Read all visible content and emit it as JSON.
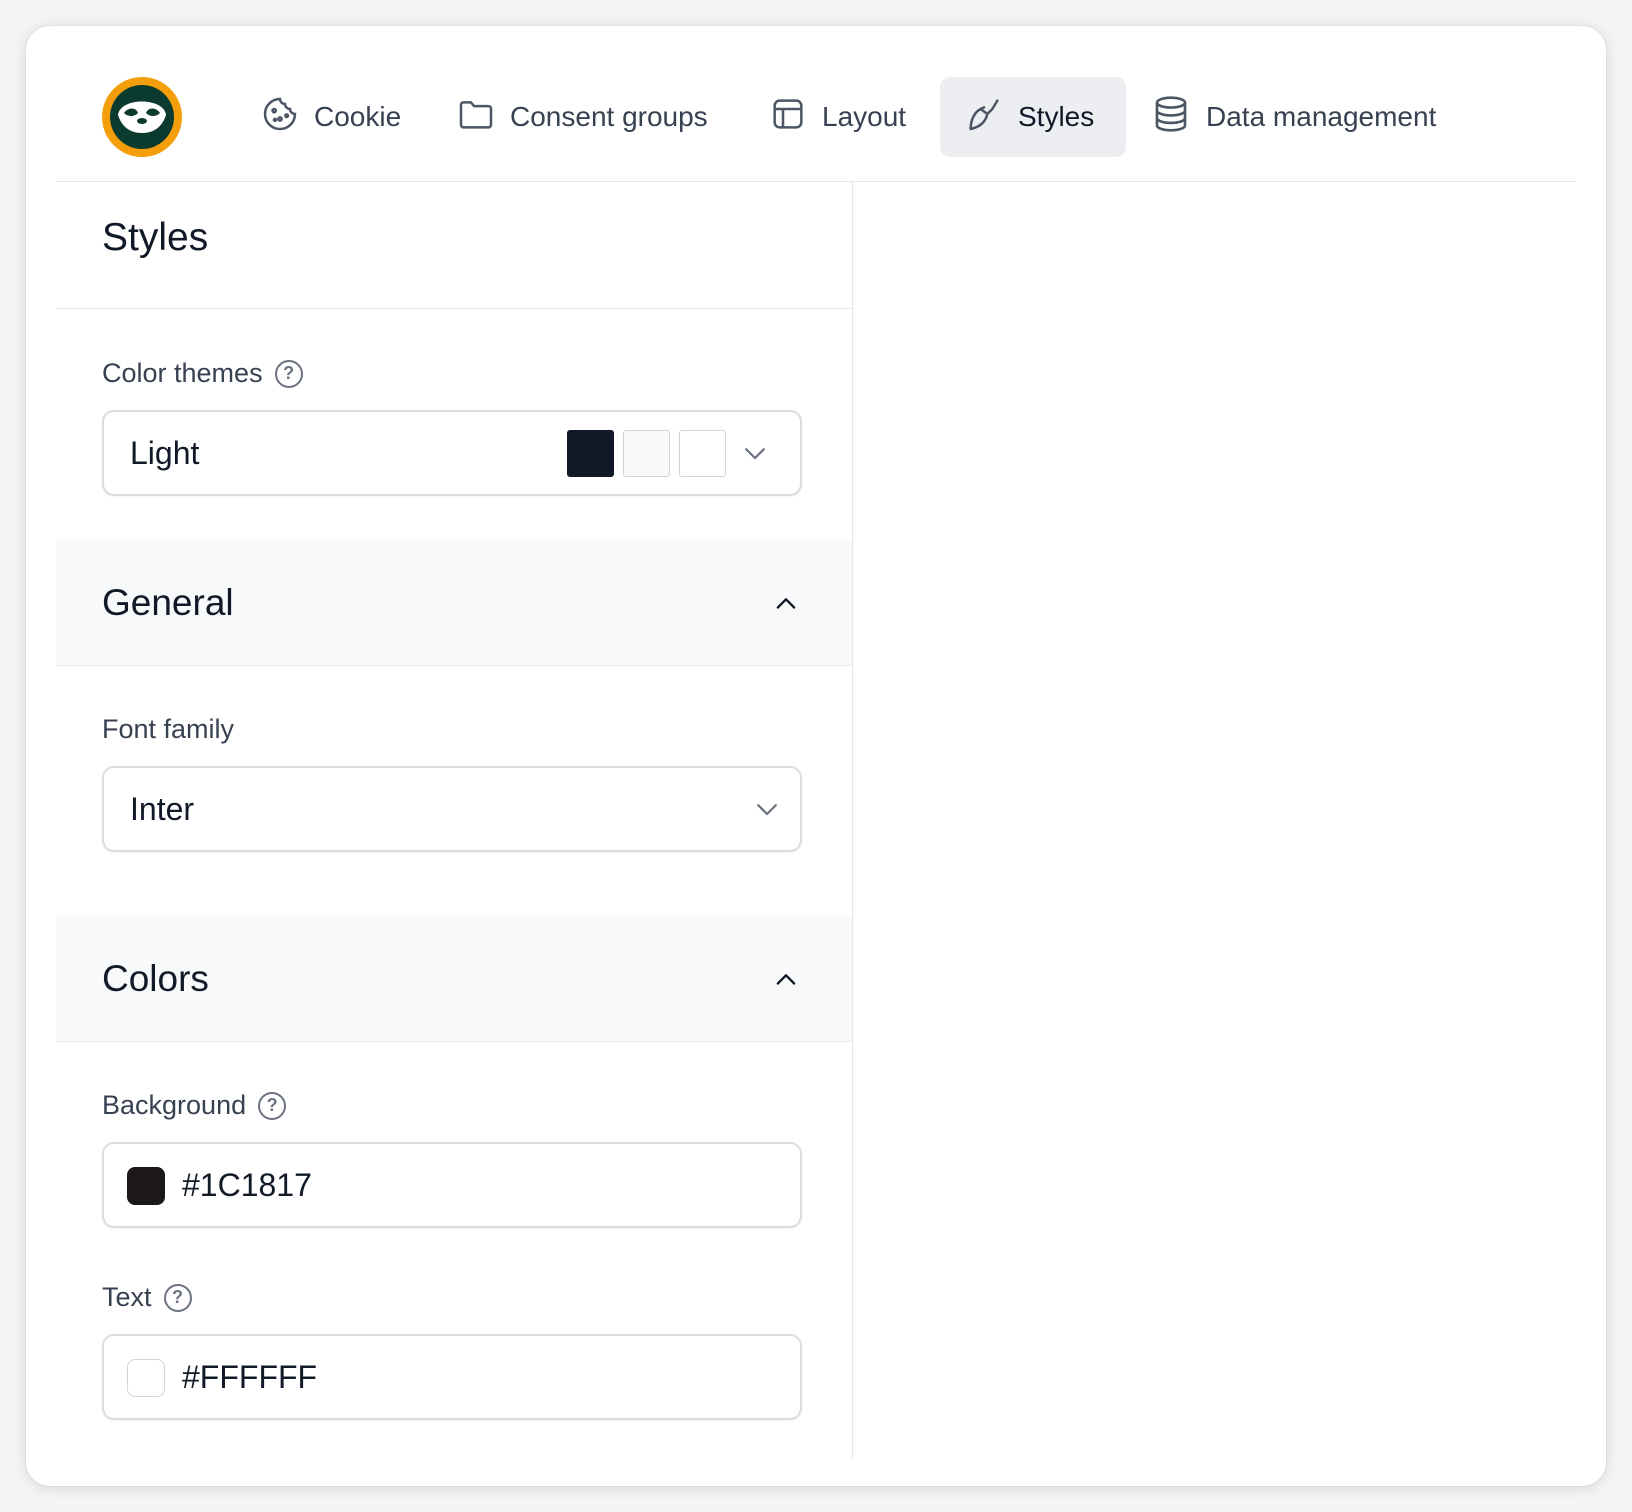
{
  "nav": {
    "items": [
      {
        "label": "Cookie",
        "icon": "cookie-icon"
      },
      {
        "label": "Consent groups",
        "icon": "folder-icon"
      },
      {
        "label": "Layout",
        "icon": "layout-icon"
      },
      {
        "label": "Styles",
        "icon": "brush-icon",
        "active": true
      },
      {
        "label": "Data management",
        "icon": "database-icon"
      }
    ]
  },
  "panel": {
    "title": "Styles",
    "color_themes": {
      "label": "Color themes",
      "value": "Light",
      "swatches": [
        "#111827",
        "#f8f9fb",
        "#ffffff"
      ]
    },
    "general": {
      "title": "General",
      "font_family_label": "Font family",
      "font_family_value": "Inter"
    },
    "colors": {
      "title": "Colors",
      "background_label": "Background",
      "background_value": "#1C1817",
      "text_label": "Text",
      "text_value": "#FFFFFF"
    }
  },
  "theme": {
    "accent": "#f59e0b",
    "logo_dark": "#0b3b2e",
    "active_tab_bg": "#eceef1"
  }
}
